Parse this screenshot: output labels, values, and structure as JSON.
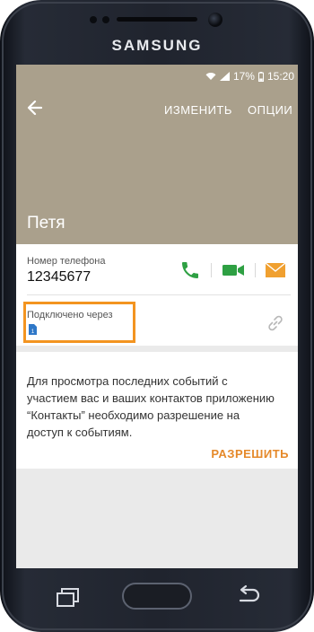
{
  "device": {
    "brand": "SAMSUNG"
  },
  "status_bar": {
    "battery": "17%",
    "time": "15:20",
    "wifi_icon": "wifi-icon",
    "signal_icon": "signal-icon",
    "battery_icon": "battery-icon"
  },
  "header": {
    "back_icon": "back-arrow-icon",
    "edit_label": "ИЗМЕНИТЬ",
    "options_label": "ОПЦИИ",
    "contact_name": "Петя",
    "background_color": "#aaa08c"
  },
  "phone_row": {
    "label": "Номер телефона",
    "number": "12345677",
    "actions": [
      "phone-call-icon",
      "video-call-icon",
      "message-icon"
    ],
    "call_color": "#2ea043",
    "video_color": "#2ea043",
    "message_color": "#f0a030"
  },
  "linked_row": {
    "label": "Подключено через",
    "sim_badge": "1",
    "link_icon": "link-icon",
    "highlight_color": "#f39420"
  },
  "permission_card": {
    "text": "Для просмотра последних событий с участием вас и ваших контактов приложению “Контакты” необходимо разрешение на доступ к событиям.",
    "allow_label": "РАЗРЕШИТЬ",
    "accent_color": "#e5892a"
  },
  "hardware_keys": {
    "recent": "recent-apps-icon",
    "home": "home-button",
    "back": "back-key-icon"
  }
}
